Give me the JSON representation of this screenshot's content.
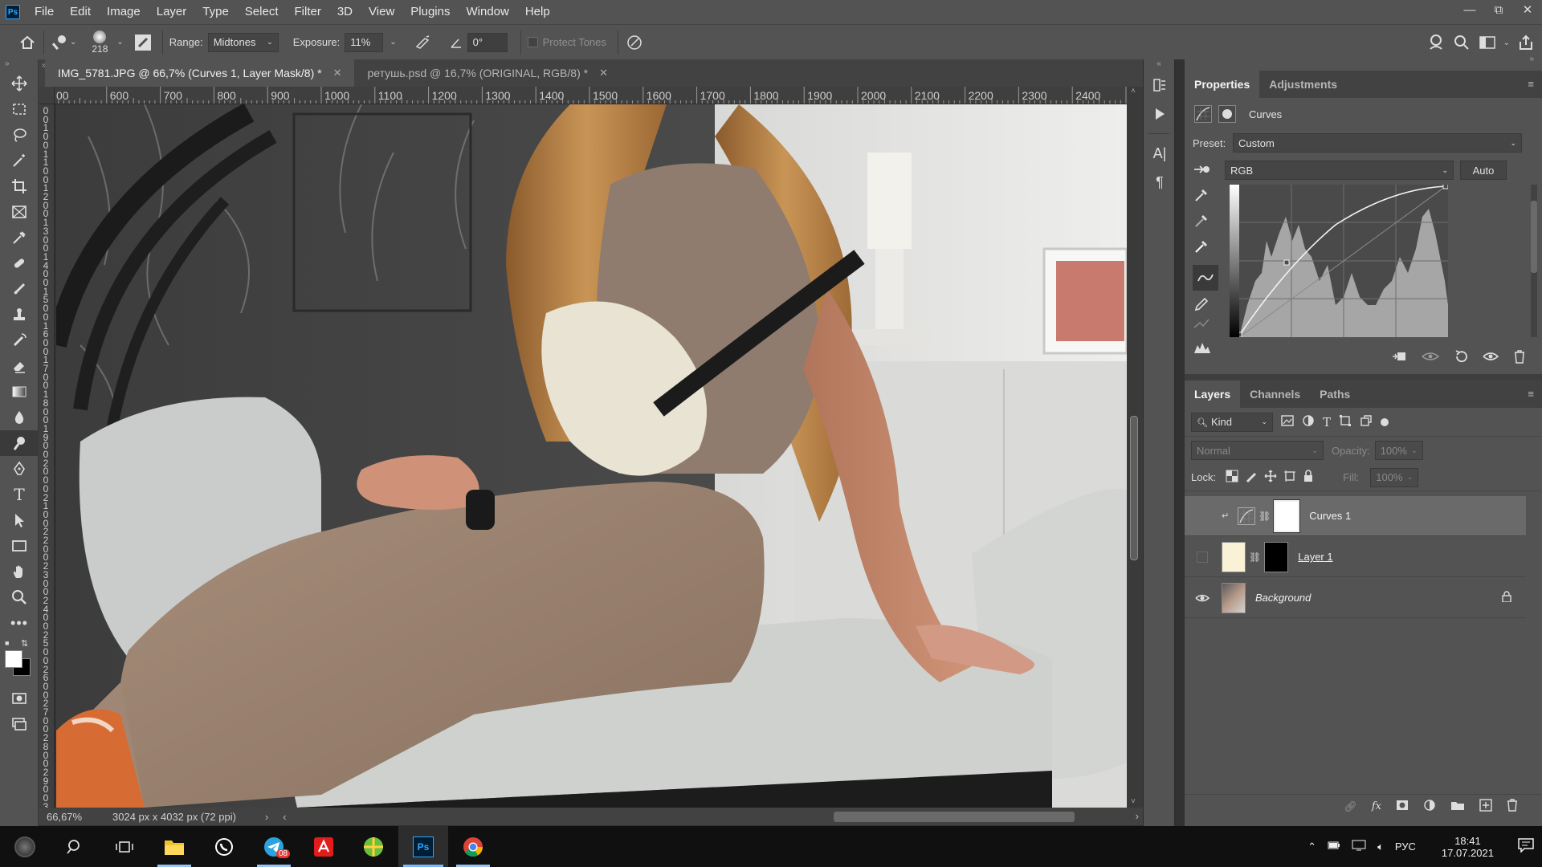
{
  "menu": {
    "logo": "Ps",
    "items": [
      "File",
      "Edit",
      "Image",
      "Layer",
      "Type",
      "Select",
      "Filter",
      "3D",
      "View",
      "Plugins",
      "Window",
      "Help"
    ]
  },
  "options": {
    "brush_size": "218",
    "range_label": "Range:",
    "range_value": "Midtones",
    "exposure_label": "Exposure:",
    "exposure_value": "11%",
    "angle_value": "0°",
    "protect_tones": "Protect Tones"
  },
  "tabs": [
    {
      "label": "IMG_5781.JPG @ 66,7% (Curves 1, Layer Mask/8) *",
      "active": true
    },
    {
      "label": "ретушь.psd @ 16,7% (ORIGINAL, RGB/8) *",
      "active": false
    }
  ],
  "ruler_top": [
    "00",
    "600",
    "700",
    "800",
    "900",
    "1000",
    "1100",
    "1200",
    "1300",
    "1400",
    "1500",
    "1600",
    "1700",
    "1800",
    "1900",
    "2000",
    "2100",
    "2200",
    "2300",
    "2400",
    "2"
  ],
  "ruler_left": [
    "0",
    "0",
    "1",
    "0",
    "0",
    "1",
    "1",
    "0",
    "0",
    "1",
    "2",
    "0",
    "0",
    "1",
    "3",
    "0",
    "0",
    "1",
    "4",
    "0",
    "0",
    "1",
    "5",
    "0",
    "0",
    "1",
    "6",
    "0",
    "0",
    "1",
    "7",
    "0",
    "0",
    "1",
    "8",
    "0",
    "0",
    "1",
    "9",
    "0",
    "0",
    "2",
    "0",
    "0",
    "0",
    "2",
    "1",
    "0",
    "0",
    "2",
    "2",
    "0",
    "0",
    "2",
    "3",
    "0",
    "0",
    "2",
    "4",
    "0",
    "0",
    "2",
    "5",
    "0",
    "0",
    "2",
    "6",
    "0",
    "0",
    "2",
    "7",
    "0",
    "0",
    "2",
    "8",
    "0",
    "0",
    "2",
    "9",
    "0",
    "0",
    "3"
  ],
  "status": {
    "zoom": "66,67%",
    "doc_info": "3024 px x 4032 px (72 ppi)"
  },
  "properties": {
    "tab_properties": "Properties",
    "tab_adjustments": "Adjustments",
    "title": "Curves",
    "preset_label": "Preset:",
    "preset_value": "Custom",
    "channel_value": "RGB",
    "auto_button": "Auto"
  },
  "layers_panel": {
    "tab_layers": "Layers",
    "tab_channels": "Channels",
    "tab_paths": "Paths",
    "filter_kind": "Kind",
    "blend_mode": "Normal",
    "opacity_label": "Opacity:",
    "opacity_value": "100%",
    "lock_label": "Lock:",
    "fill_label": "Fill:",
    "fill_value": "100%",
    "layers": [
      {
        "name": "Curves 1",
        "visible": false,
        "selected": true
      },
      {
        "name": "Layer 1",
        "visible": false,
        "selected": false
      },
      {
        "name": "Background",
        "visible": true,
        "selected": false
      }
    ]
  },
  "taskbar": {
    "lang": "РУС",
    "time": "18:41",
    "date": "17.07.2021",
    "telegram_badge": "08"
  },
  "colors": {
    "accent": "#31a8ff",
    "panel_bg": "#535353",
    "dark_bg": "#424242"
  }
}
